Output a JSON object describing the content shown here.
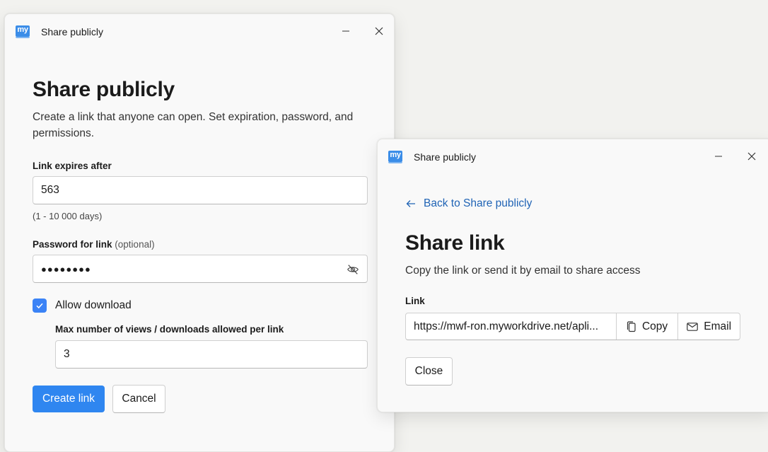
{
  "share_window": {
    "title": "Share publicly",
    "heading": "Share publicly",
    "description": "Create a link that anyone can open. Set expiration, password, and permissions.",
    "expires_label": "Link expires after",
    "expires_value": "563",
    "expires_hint": "(1 - 10 000 days)",
    "password_label": "Password for link",
    "password_optional": "(optional)",
    "password_masked": "●●●●●●●●",
    "allow_download_label": "Allow download",
    "allow_download_checked": true,
    "max_views_label": "Max number of views / downloads allowed per link",
    "max_views_value": "3",
    "create_button": "Create link",
    "cancel_button": "Cancel"
  },
  "link_window": {
    "title": "Share publicly",
    "back_link": "Back to Share publicly",
    "heading": "Share link",
    "description": "Copy the link or send it by email to share access",
    "link_label": "Link",
    "link_value": "https://mwf-ron.myworkdrive.net/apli...",
    "copy_button": "Copy",
    "email_button": "Email",
    "close_button": "Close"
  },
  "app": {
    "logo_text": "my",
    "accent_color": "#2f86f0",
    "link_color": "#1f63b5"
  }
}
